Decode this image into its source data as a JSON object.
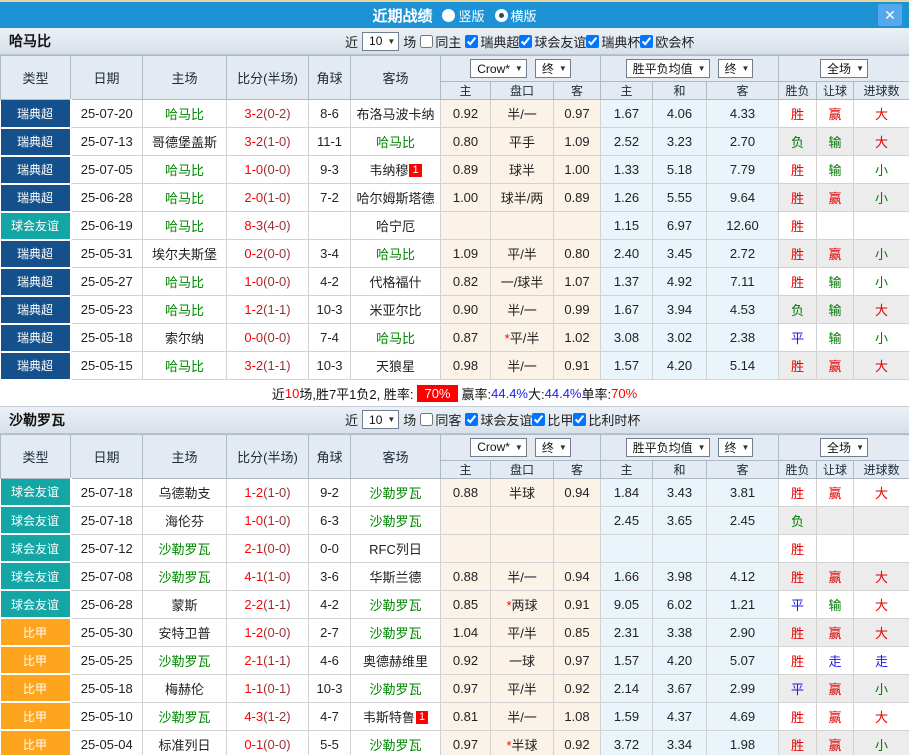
{
  "titlebar": {
    "title": "近期战绩",
    "vertical_label": "竖版",
    "horizontal_label": "横版",
    "close": "✕"
  },
  "columns": {
    "type": "类型",
    "date": "日期",
    "home": "主场",
    "score": "比分(半场)",
    "corner": "角球",
    "away": "客场",
    "odds_home": "主",
    "handicap": "盘口",
    "odds_away": "客",
    "avg_home": "主",
    "avg_draw": "和",
    "avg_away": "客",
    "result": "胜负",
    "handicap_result": "让球",
    "goal_result": "进球数"
  },
  "dropdowns": {
    "crow": "Crow*",
    "final1": "终",
    "avg": "胜平负均值",
    "final2": "终",
    "fullmatch": "全场"
  },
  "colors": {
    "titlebar_blue": "#1d93d6",
    "close_blue": "#55a8e9",
    "top_strip": "#e7d79b",
    "win_red": "#e60000",
    "lose_green": "#007a00",
    "draw_blue": "#1a1ae6",
    "focal_green": "#008800",
    "score_red": "#ff0000",
    "half_maroon": "#993333",
    "crow_bg": "#fbf3e7",
    "avg_bg": "#eaf4fb",
    "alt_gray": "#ececec"
  },
  "league_colors": {
    "瑞典超": "#14518c",
    "球会友谊": "#14a5a5",
    "比甲": "#ffa41d"
  },
  "sections": [
    {
      "team": "哈马比",
      "filter": {
        "near": "近",
        "count": "10",
        "unit": "场",
        "same": "同主",
        "leagues": [
          "瑞典超",
          "球会友谊",
          "瑞典杯",
          "欧会杯"
        ]
      },
      "rows": [
        {
          "type": "瑞典超",
          "date": "25-07-20",
          "home": "哈马比",
          "score": "3-2",
          "half": "(0-2)",
          "corner": "8-6",
          "away": "布洛马波卡纳",
          "away_badge": "",
          "odds_home": "0.92",
          "handicap": "半/一",
          "odds_away": "0.97",
          "avg_home": "1.67",
          "avg_draw": "4.06",
          "avg_away": "4.33",
          "result": "胜",
          "handicap_result": "赢",
          "goal_result": "大"
        },
        {
          "type": "瑞典超",
          "date": "25-07-13",
          "home": "哥德堡盖斯",
          "score": "3-2",
          "half": "(1-0)",
          "corner": "11-1",
          "away": "哈马比",
          "away_badge": "",
          "odds_home": "0.80",
          "handicap": "平手",
          "odds_away": "1.09",
          "avg_home": "2.52",
          "avg_draw": "3.23",
          "avg_away": "2.70",
          "result": "负",
          "handicap_result": "输",
          "goal_result": "大"
        },
        {
          "type": "瑞典超",
          "date": "25-07-05",
          "home": "哈马比",
          "score": "1-0",
          "half": "(0-0)",
          "corner": "9-3",
          "away": "韦纳穆",
          "away_badge": "1",
          "odds_home": "0.89",
          "handicap": "球半",
          "odds_away": "1.00",
          "avg_home": "1.33",
          "avg_draw": "5.18",
          "avg_away": "7.79",
          "result": "胜",
          "handicap_result": "输",
          "goal_result": "小"
        },
        {
          "type": "瑞典超",
          "date": "25-06-28",
          "home": "哈马比",
          "score": "2-0",
          "half": "(1-0)",
          "corner": "7-2",
          "away": "哈尔姆斯塔德",
          "away_badge": "",
          "odds_home": "1.00",
          "handicap": "球半/两",
          "odds_away": "0.89",
          "avg_home": "1.26",
          "avg_draw": "5.55",
          "avg_away": "9.64",
          "result": "胜",
          "handicap_result": "赢",
          "goal_result": "小"
        },
        {
          "type": "球会友谊",
          "date": "25-06-19",
          "home": "哈马比",
          "score": "8-3",
          "half": "(4-0)",
          "corner": "",
          "away": "哈宁厄",
          "away_badge": "",
          "odds_home": "",
          "handicap": "",
          "odds_away": "",
          "avg_home": "1.15",
          "avg_draw": "6.97",
          "avg_away": "12.60",
          "result": "胜",
          "handicap_result": "",
          "goal_result": ""
        },
        {
          "type": "瑞典超",
          "date": "25-05-31",
          "home": "埃尔夫斯堡",
          "score": "0-2",
          "half": "(0-0)",
          "corner": "3-4",
          "away": "哈马比",
          "away_badge": "",
          "odds_home": "1.09",
          "handicap": "平/半",
          "odds_away": "0.80",
          "avg_home": "2.40",
          "avg_draw": "3.45",
          "avg_away": "2.72",
          "result": "胜",
          "handicap_result": "赢",
          "goal_result": "小"
        },
        {
          "type": "瑞典超",
          "date": "25-05-27",
          "home": "哈马比",
          "score": "1-0",
          "half": "(0-0)",
          "corner": "4-2",
          "away": "代格福什",
          "away_badge": "",
          "odds_home": "0.82",
          "handicap": "一/球半",
          "odds_away": "1.07",
          "avg_home": "1.37",
          "avg_draw": "4.92",
          "avg_away": "7.11",
          "result": "胜",
          "handicap_result": "输",
          "goal_result": "小"
        },
        {
          "type": "瑞典超",
          "date": "25-05-23",
          "home": "哈马比",
          "score": "1-2",
          "half": "(1-1)",
          "corner": "10-3",
          "away": "米亚尔比",
          "away_badge": "",
          "odds_home": "0.90",
          "handicap": "半/一",
          "odds_away": "0.99",
          "avg_home": "1.67",
          "avg_draw": "3.94",
          "avg_away": "4.53",
          "result": "负",
          "handicap_result": "输",
          "goal_result": "大"
        },
        {
          "type": "瑞典超",
          "date": "25-05-18",
          "home": "索尔纳",
          "score": "0-0",
          "half": "(0-0)",
          "corner": "7-4",
          "away": "哈马比",
          "away_badge": "",
          "odds_home": "0.87",
          "handicap": "*平/半",
          "odds_away": "1.02",
          "avg_home": "3.08",
          "avg_draw": "3.02",
          "avg_away": "2.38",
          "result": "平",
          "handicap_result": "输",
          "goal_result": "小"
        },
        {
          "type": "瑞典超",
          "date": "25-05-15",
          "home": "哈马比",
          "score": "3-2",
          "half": "(1-1)",
          "corner": "10-3",
          "away": "天狼星",
          "away_badge": "",
          "odds_home": "0.98",
          "handicap": "半/一",
          "odds_away": "0.91",
          "avg_home": "1.57",
          "avg_draw": "4.20",
          "avg_away": "5.14",
          "result": "胜",
          "handicap_result": "赢",
          "goal_result": "大"
        }
      ],
      "summary": [
        {
          "text": "近",
          "style": "plain"
        },
        {
          "text": "10",
          "style": "red"
        },
        {
          "text": "场,胜7平1负2, 胜率:",
          "style": "plain"
        },
        {
          "text": "70%",
          "style": "redbox"
        },
        {
          "text": "赢率:",
          "style": "plain"
        },
        {
          "text": "44.4%",
          "style": "blue"
        },
        {
          "text": " 大:",
          "style": "plain"
        },
        {
          "text": "44.4%",
          "style": "blue"
        },
        {
          "text": " 单率:",
          "style": "plain"
        },
        {
          "text": "70%",
          "style": "red"
        }
      ]
    },
    {
      "team": "沙勒罗瓦",
      "filter": {
        "near": "近",
        "count": "10",
        "unit": "场",
        "same": "同客",
        "leagues": [
          "球会友谊",
          "比甲",
          "比利时杯"
        ]
      },
      "rows": [
        {
          "type": "球会友谊",
          "date": "25-07-18",
          "home": "乌德勒支",
          "score": "1-2",
          "half": "(1-0)",
          "corner": "9-2",
          "away": "沙勒罗瓦",
          "away_badge": "",
          "odds_home": "0.88",
          "handicap": "半球",
          "odds_away": "0.94",
          "avg_home": "1.84",
          "avg_draw": "3.43",
          "avg_away": "3.81",
          "result": "胜",
          "handicap_result": "赢",
          "goal_result": "大"
        },
        {
          "type": "球会友谊",
          "date": "25-07-18",
          "home": "海伦芬",
          "score": "1-0",
          "half": "(1-0)",
          "corner": "6-3",
          "away": "沙勒罗瓦",
          "away_badge": "",
          "odds_home": "",
          "handicap": "",
          "odds_away": "",
          "avg_home": "2.45",
          "avg_draw": "3.65",
          "avg_away": "2.45",
          "result": "负",
          "handicap_result": "",
          "goal_result": ""
        },
        {
          "type": "球会友谊",
          "date": "25-07-12",
          "home": "沙勒罗瓦",
          "score": "2-1",
          "half": "(0-0)",
          "corner": "0-0",
          "away": "RFC列日",
          "away_badge": "",
          "odds_home": "",
          "handicap": "",
          "odds_away": "",
          "avg_home": "",
          "avg_draw": "",
          "avg_away": "",
          "result": "胜",
          "handicap_result": "",
          "goal_result": ""
        },
        {
          "type": "球会友谊",
          "date": "25-07-08",
          "home": "沙勒罗瓦",
          "score": "4-1",
          "half": "(1-0)",
          "corner": "3-6",
          "away": "华斯兰德",
          "away_badge": "",
          "odds_home": "0.88",
          "handicap": "半/一",
          "odds_away": "0.94",
          "avg_home": "1.66",
          "avg_draw": "3.98",
          "avg_away": "4.12",
          "result": "胜",
          "handicap_result": "赢",
          "goal_result": "大"
        },
        {
          "type": "球会友谊",
          "date": "25-06-28",
          "home": "蒙斯",
          "score": "2-2",
          "half": "(1-1)",
          "corner": "4-2",
          "away": "沙勒罗瓦",
          "away_badge": "",
          "odds_home": "0.85",
          "handicap": "*两球",
          "odds_away": "0.91",
          "avg_home": "9.05",
          "avg_draw": "6.02",
          "avg_away": "1.21",
          "result": "平",
          "handicap_result": "输",
          "goal_result": "大"
        },
        {
          "type": "比甲",
          "date": "25-05-30",
          "home": "安特卫普",
          "score": "1-2",
          "half": "(0-0)",
          "corner": "2-7",
          "away": "沙勒罗瓦",
          "away_badge": "",
          "odds_home": "1.04",
          "handicap": "平/半",
          "odds_away": "0.85",
          "avg_home": "2.31",
          "avg_draw": "3.38",
          "avg_away": "2.90",
          "result": "胜",
          "handicap_result": "赢",
          "goal_result": "大"
        },
        {
          "type": "比甲",
          "date": "25-05-25",
          "home": "沙勒罗瓦",
          "score": "2-1",
          "half": "(1-1)",
          "corner": "4-6",
          "away": "奥德赫维里",
          "away_badge": "",
          "odds_home": "0.92",
          "handicap": "一球",
          "odds_away": "0.97",
          "avg_home": "1.57",
          "avg_draw": "4.20",
          "avg_away": "5.07",
          "result": "胜",
          "handicap_result": "走",
          "goal_result": "走"
        },
        {
          "type": "比甲",
          "date": "25-05-18",
          "home": "梅赫伦",
          "score": "1-1",
          "half": "(0-1)",
          "corner": "10-3",
          "away": "沙勒罗瓦",
          "away_badge": "",
          "odds_home": "0.97",
          "handicap": "平/半",
          "odds_away": "0.92",
          "avg_home": "2.14",
          "avg_draw": "3.67",
          "avg_away": "2.99",
          "result": "平",
          "handicap_result": "赢",
          "goal_result": "小"
        },
        {
          "type": "比甲",
          "date": "25-05-10",
          "home": "沙勒罗瓦",
          "score": "4-3",
          "half": "(1-2)",
          "corner": "4-7",
          "away": "韦斯特鲁",
          "away_badge": "1",
          "odds_home": "0.81",
          "handicap": "半/一",
          "odds_away": "1.08",
          "avg_home": "1.59",
          "avg_draw": "4.37",
          "avg_away": "4.69",
          "result": "胜",
          "handicap_result": "赢",
          "goal_result": "大"
        },
        {
          "type": "比甲",
          "date": "25-05-04",
          "home": "标准列日",
          "score": "0-1",
          "half": "(0-0)",
          "corner": "5-5",
          "away": "沙勒罗瓦",
          "away_badge": "",
          "odds_home": "0.97",
          "handicap": "*半球",
          "odds_away": "0.92",
          "avg_home": "3.72",
          "avg_draw": "3.34",
          "avg_away": "1.98",
          "result": "胜",
          "handicap_result": "赢",
          "goal_result": "小"
        }
      ]
    }
  ]
}
